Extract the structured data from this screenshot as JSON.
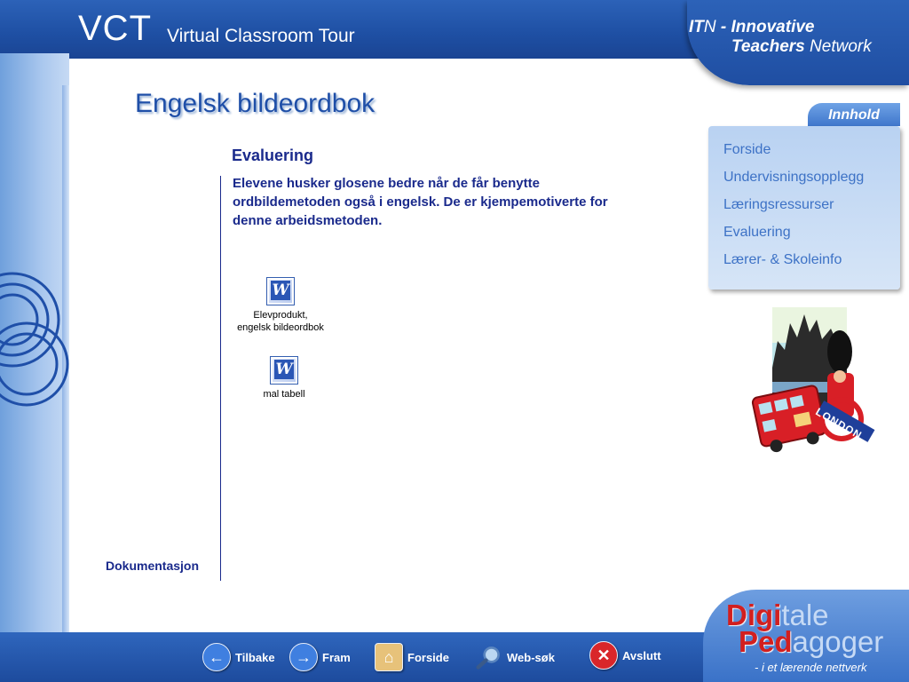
{
  "header": {
    "brand": "VCT",
    "brand_sub": "Virtual Classroom Tour",
    "itn_line1_a": "IT",
    "itn_line1_b": "N",
    "itn_line1_c": " - Innovative",
    "itn_line2_a": "Teachers",
    "itn_line2_b": " Network"
  },
  "page": {
    "title": "Engelsk bildeordbok",
    "section_title": "Evaluering",
    "body": "Elevene husker glosene bedre når de får benytte ordbildemetoden også i engelsk.  De er kjempemotiverte for denne arbeidsmetoden.",
    "doc_label": "Dokumentasjon"
  },
  "files": [
    {
      "line1": "Elevprodukt,",
      "line2": "engelsk bildeordbok",
      "icon": "word-document-icon"
    },
    {
      "line1": "mal tabell",
      "line2": "",
      "icon": "word-document-icon"
    }
  ],
  "sidebar": {
    "tab_label": "Innhold",
    "items": [
      {
        "label": "Forside"
      },
      {
        "label": "Undervisningsopplegg"
      },
      {
        "label": "Læringsressurser"
      },
      {
        "label": "Evaluering"
      },
      {
        "label": "Lærer- & Skoleinfo"
      }
    ]
  },
  "london_badge": "LONDON",
  "nav": {
    "back": "Tilbake",
    "forward": "Fram",
    "home": "Forside",
    "search": "Web-søk",
    "exit": "Avslutt"
  },
  "footer_brand": {
    "digi": "Digi",
    "tale": "tale",
    "ped": "Ped",
    "agoger": "agoger",
    "tagline": "- i et lærende nettverk"
  },
  "colors": {
    "accent": "#1f4fa8",
    "menu_text": "#3d72c6",
    "body_text": "#1a2a8c",
    "brand_red": "#d21f1f"
  }
}
